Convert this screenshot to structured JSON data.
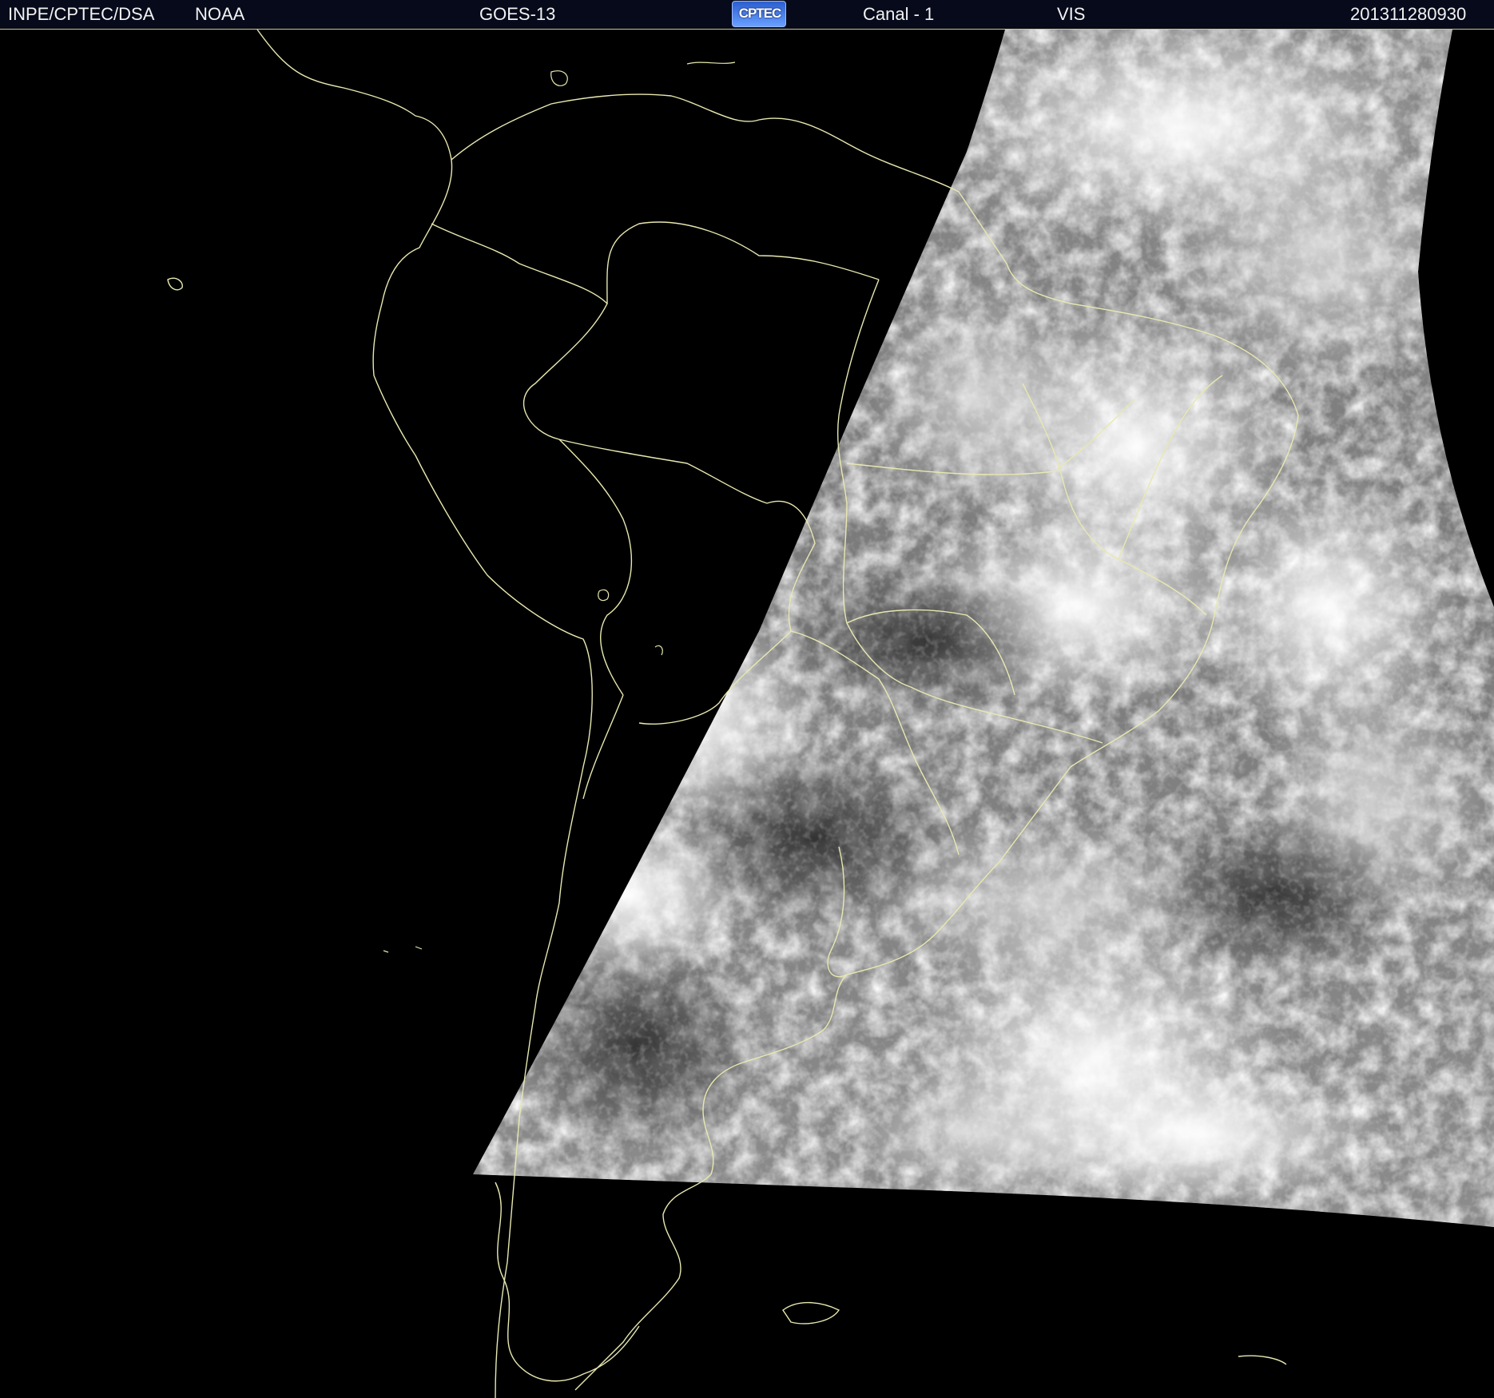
{
  "header": {
    "source": "INPE/CPTEC/DSA",
    "agency": "NOAA",
    "satellite": "GOES-13",
    "logo_text": "CPTEC",
    "channel": "Canal - 1",
    "band": "VIS",
    "timestamp": "201311280930"
  },
  "colors": {
    "background": "#000000",
    "header_background": "#060a1a",
    "coastline": "#e8e8b0",
    "header_text": "#f2f2f2"
  },
  "icons": {
    "logo": "cptec-logo-icon"
  }
}
